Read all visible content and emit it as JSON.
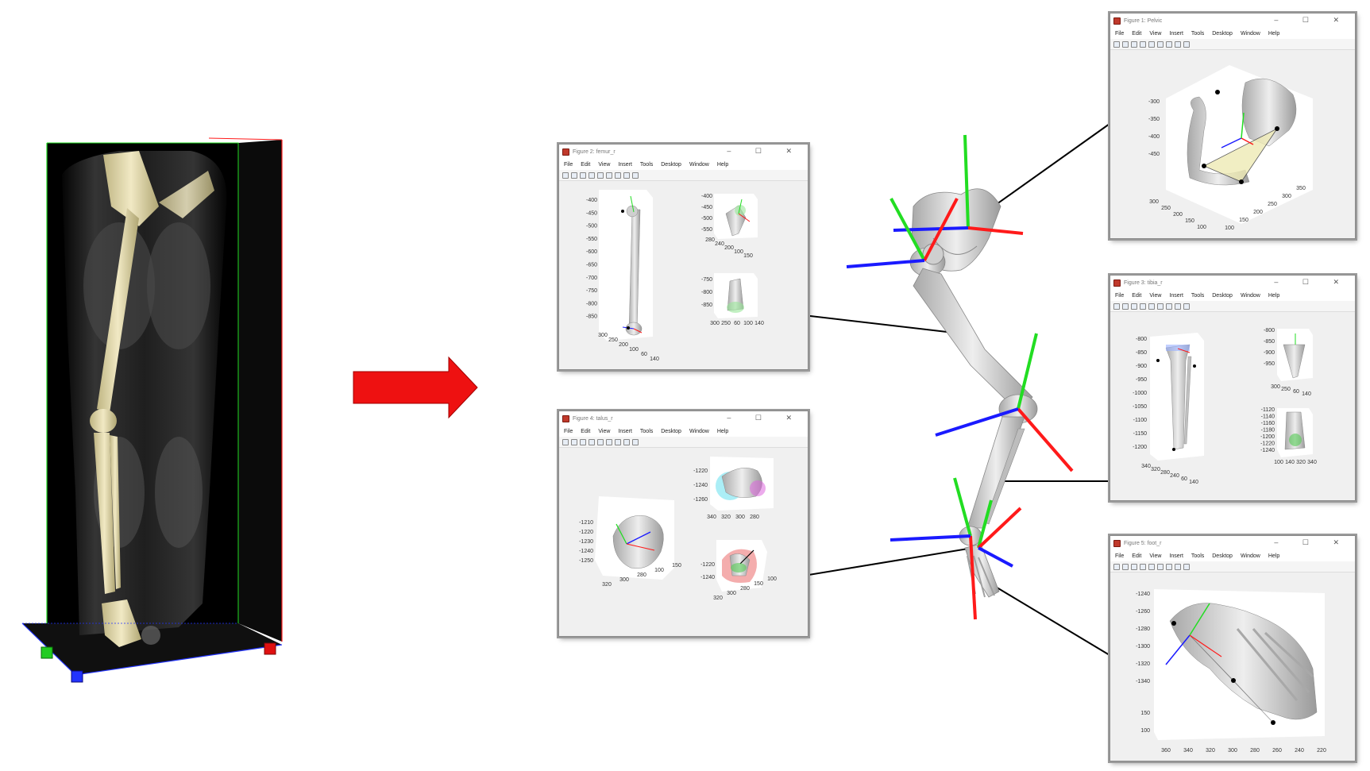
{
  "menu": [
    "File",
    "Edit",
    "View",
    "Insert",
    "Tools",
    "Desktop",
    "Window",
    "Help"
  ],
  "window_buttons": "– ☐ ✕",
  "figures": {
    "pelvic": {
      "title": "Figure 1: Pelvic",
      "zticks": [
        "-300",
        "-350",
        "-400",
        "-450"
      ],
      "xticks": [
        "300",
        "250",
        "200",
        "150",
        "100"
      ],
      "yticks": [
        "100",
        "150",
        "200",
        "250",
        "300",
        "350"
      ]
    },
    "femur": {
      "title": "Figure 2: femur_r",
      "main_zticks": [
        "-400",
        "-450",
        "-500",
        "-550",
        "-600",
        "-650",
        "-700",
        "-750",
        "-800",
        "-850"
      ],
      "main_xticks": [
        "300",
        "250",
        "200",
        "100",
        "60",
        "140"
      ],
      "top_zticks": [
        "-400",
        "-450",
        "-500",
        "-550"
      ],
      "top_xticks": [
        "280",
        "240",
        "200",
        "100",
        "150"
      ],
      "bot_zticks": [
        "-750",
        "-800",
        "-850"
      ],
      "bot_xticks": [
        "300",
        "250",
        "60",
        "100",
        "140"
      ]
    },
    "tibia": {
      "title": "Figure 3: tibia_r",
      "main_zticks": [
        "-800",
        "-850",
        "-900",
        "-950",
        "-1000",
        "-1050",
        "-1100",
        "-1150",
        "-1200"
      ],
      "main_xticks": [
        "340",
        "320",
        "280",
        "240",
        "60",
        "140"
      ],
      "top_zticks": [
        "-800",
        "-850",
        "-900",
        "-950"
      ],
      "top_xticks": [
        "300",
        "250",
        "60",
        "140"
      ],
      "bot_zticks": [
        "-1120",
        "-1140",
        "-1160",
        "-1180",
        "-1200",
        "-1220",
        "-1240"
      ],
      "bot_xticks": [
        "100",
        "140",
        "320",
        "340"
      ]
    },
    "talus": {
      "title": "Figure 4: talus_r",
      "main_zticks": [
        "-1210",
        "-1220",
        "-1230",
        "-1240",
        "-1250"
      ],
      "main_xticks": [
        "320",
        "300",
        "280",
        "100",
        "150"
      ],
      "top_zticks": [
        "-1220",
        "-1240",
        "-1260"
      ],
      "top_xticks": [
        "340",
        "320",
        "300",
        "280"
      ],
      "bot_zticks": [
        "-1220",
        "-1240"
      ],
      "bot_xticks": [
        "320",
        "300",
        "280",
        "150",
        "100"
      ]
    },
    "foot": {
      "title": "Figure 5: foot_r",
      "zticks": [
        "-1240",
        "-1260",
        "-1280",
        "-1300",
        "-1320",
        "-1340"
      ],
      "yticks": [
        "100",
        "150"
      ],
      "xticks": [
        "360",
        "340",
        "320",
        "300",
        "280",
        "260",
        "240",
        "220"
      ]
    }
  },
  "colors": {
    "arrow": "#ee1111",
    "axis_x": "#ff1a1a",
    "axis_y": "#22dd22",
    "axis_z": "#1a1aff",
    "bone": "#d8d8d8",
    "scan_bone": "#e8dfb0"
  }
}
